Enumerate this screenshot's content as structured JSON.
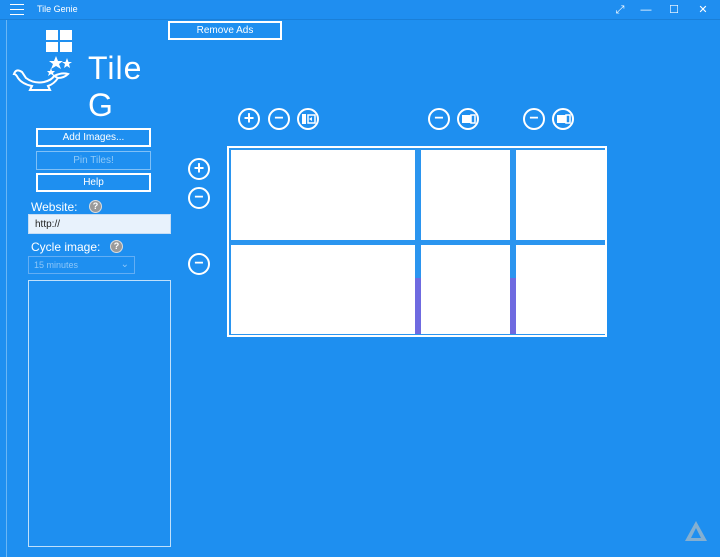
{
  "window": {
    "title": "Tile Genie",
    "controls": {
      "fullscreen": "⤢",
      "minimize": "—",
      "maximize": "☐",
      "close": "✕"
    }
  },
  "app": {
    "logo_text": "Tile G",
    "remove_ads_label": "Remove Ads"
  },
  "sidebar": {
    "add_images_label": "Add Images...",
    "pin_tiles_label": "Pin Tiles!",
    "help_label": "Help",
    "website_label": "Website:",
    "website_value": "http://",
    "cycle_label": "Cycle image:",
    "cycle_value": "15 minutes",
    "help_glyph": "?"
  },
  "grid_controls": {
    "add_glyph": "+",
    "remove_glyph": "−"
  },
  "colors": {
    "background": "#1e8ff0",
    "tile": "#ffffff",
    "accent_stripe": "#6f6ae0"
  },
  "icons": [
    "hamburger-icon",
    "genie-lamp-icon",
    "help-icon",
    "plus-icon",
    "minus-icon",
    "resize-icon"
  ]
}
